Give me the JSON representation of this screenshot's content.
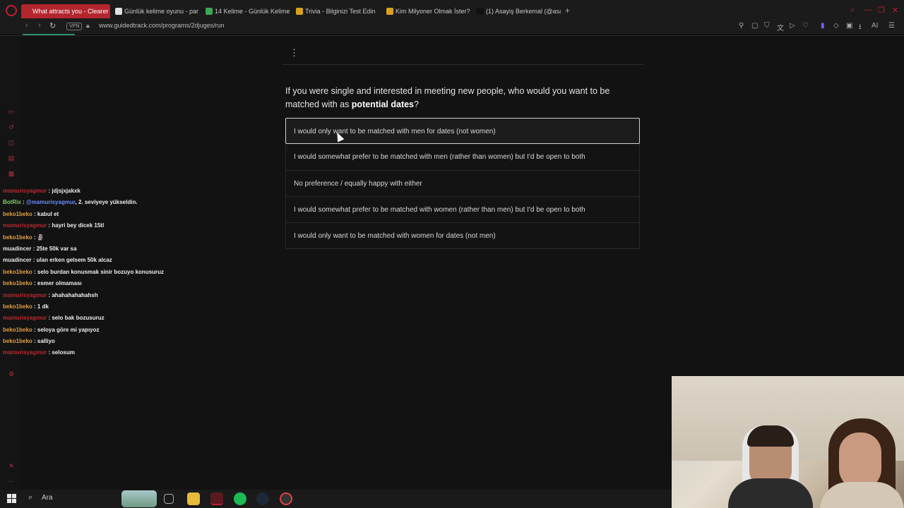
{
  "tabs": [
    {
      "label": "What attracts you - Clearer",
      "active": true,
      "color": "#b3262e"
    },
    {
      "label": "Günlük kelime oyunu - par",
      "active": false,
      "color": "#e0e0e0"
    },
    {
      "label": "14 Kelime - Günlük Kelime",
      "active": false,
      "color": "#3aa757"
    },
    {
      "label": "Trivia - Bilginizi Test Edin",
      "active": false,
      "color": "#d9a21b"
    },
    {
      "label": "Kim Milyoner Olmak İster?",
      "active": false,
      "color": "#d9a21b"
    },
    {
      "label": "(1) Asayiş Berkemal (@asay",
      "active": false,
      "color": "#111111"
    }
  ],
  "address": {
    "vpn": "VPN",
    "url": "www.guidedtrack.com/programs/2djuges/run"
  },
  "toolbar": {
    "ai_label": "AI"
  },
  "chat": [
    {
      "user": "mamurisyagmur",
      "type": "a",
      "text": "jdjsjxjakxk"
    },
    {
      "user": "BotRix",
      "type": "d",
      "mention": "@mamurisyagmur",
      "text": "2. seviyeye yükseldin."
    },
    {
      "user": "beko1beko",
      "type": "b",
      "text": "kabul et"
    },
    {
      "user": "mamurisyagmur",
      "type": "a",
      "text": "hayri bey dicek 15tl"
    },
    {
      "user": "beko1beko",
      "type": "b",
      "text": "🗿"
    },
    {
      "user": "muadincer",
      "type": "c",
      "text": "25te 50k var sa"
    },
    {
      "user": "muadincer",
      "type": "c",
      "text": "ulan erken gelsem 50k alcaz"
    },
    {
      "user": "beko1beko",
      "type": "b",
      "text": "selo burdan konusmak sinir bozuyo konusuruz"
    },
    {
      "user": "beko1beko",
      "type": "b",
      "text": "esmer olmaması"
    },
    {
      "user": "mamurisyagmur",
      "type": "a",
      "text": "ahahahahahahsh"
    },
    {
      "user": "beko1beko",
      "type": "b",
      "text": "1 dk"
    },
    {
      "user": "mamurisyagmur",
      "type": "a",
      "text": "selo bak bozusuruz"
    },
    {
      "user": "beko1beko",
      "type": "b",
      "text": "seloya göre mi yapıyoz"
    },
    {
      "user": "beko1beko",
      "type": "b",
      "text": "salliyo"
    },
    {
      "user": "mamurisyagmur",
      "type": "a",
      "text": "selosum"
    }
  ],
  "survey": {
    "question_prefix": "If you were single and interested in meeting new people, who would you want to be matched with as ",
    "question_bold": "potential dates",
    "question_suffix": "?",
    "options": [
      "I would only want to be matched with men for dates (not women)",
      "I would somewhat prefer to be matched with men (rather than women) but I'd be open to both",
      "No preference / equally happy with either",
      "I would somewhat prefer to be matched with women (rather than men) but I'd be open to both",
      "I would only want to be matched with women for dates (not men)"
    ]
  },
  "taskbar": {
    "search_label": "Ara"
  }
}
